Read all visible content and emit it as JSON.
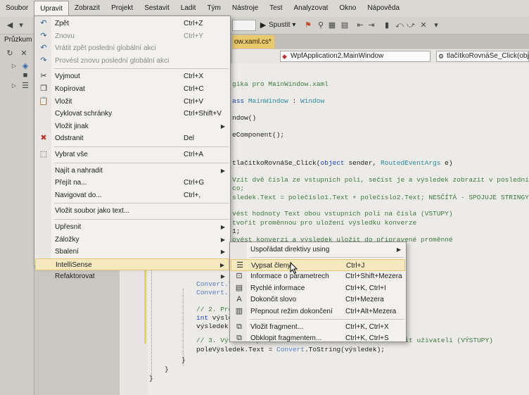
{
  "menubar": [
    "Soubor",
    "Upravit",
    "Zobrazit",
    "Projekt",
    "Sestavit",
    "Ladit",
    "Tým",
    "Nástroje",
    "Test",
    "Analyzovat",
    "Okno",
    "Nápověda"
  ],
  "toolbar": {
    "run_label": "Spustit",
    "run_arrow": "▾"
  },
  "explorer": {
    "title": "Průzkum"
  },
  "tab": {
    "label": "ow.xaml.cs*"
  },
  "nav": {
    "class_combo": "WpfApplication2.MainWindow",
    "member_combo": "tlačítkoRovnáSe_Click(object sen"
  },
  "edit_menu": [
    {
      "icon": "undo-icon",
      "glyph": "↶",
      "label": "Zpět",
      "shortcut": "Ctrl+Z",
      "enabled": true
    },
    {
      "icon": "redo-icon",
      "glyph": "↷",
      "label": "Znovu",
      "shortcut": "Ctrl+Y",
      "enabled": false
    },
    {
      "icon": "undo-global-icon",
      "glyph": "↶",
      "label": "Vrátit zpět poslední globální akci",
      "shortcut": "",
      "enabled": false
    },
    {
      "icon": "redo-global-icon",
      "glyph": "↷",
      "label": "Provést znovu poslední globální akci",
      "shortcut": "",
      "enabled": false
    },
    {
      "sep": true
    },
    {
      "icon": "cut-icon",
      "glyph": "✂",
      "label": "Vyjmout",
      "shortcut": "Ctrl+X",
      "enabled": true
    },
    {
      "icon": "copy-icon",
      "glyph": "❐",
      "label": "Kopírovat",
      "shortcut": "Ctrl+C",
      "enabled": true
    },
    {
      "icon": "paste-icon",
      "glyph": "📋",
      "label": "Vložit",
      "shortcut": "Ctrl+V",
      "enabled": true
    },
    {
      "icon": "",
      "glyph": "",
      "label": "Cyklovat schránky",
      "shortcut": "Ctrl+Shift+V",
      "enabled": true
    },
    {
      "icon": "",
      "glyph": "",
      "label": "Vložit jinak",
      "shortcut": "",
      "enabled": true,
      "submenu": true
    },
    {
      "icon": "delete-icon",
      "glyph": "✖",
      "label": "Odstranit",
      "shortcut": "Del",
      "enabled": true
    },
    {
      "sep": true
    },
    {
      "icon": "select-all-icon",
      "glyph": "⬚",
      "label": "Vybrat vše",
      "shortcut": "Ctrl+A",
      "enabled": true
    },
    {
      "sep": true
    },
    {
      "icon": "",
      "glyph": "",
      "label": "Najít a nahradit",
      "shortcut": "",
      "enabled": true,
      "submenu": true
    },
    {
      "icon": "",
      "glyph": "",
      "label": "Přejít na...",
      "shortcut": "Ctrl+G",
      "enabled": true
    },
    {
      "icon": "",
      "glyph": "",
      "label": "Navigovat do...",
      "shortcut": "Ctrl+,",
      "enabled": true
    },
    {
      "sep": true
    },
    {
      "icon": "",
      "glyph": "",
      "label": "Vložit soubor jako text...",
      "shortcut": "",
      "enabled": true
    },
    {
      "sep": true
    },
    {
      "icon": "",
      "glyph": "",
      "label": "Upřesnit",
      "shortcut": "",
      "enabled": true,
      "submenu": true
    },
    {
      "icon": "",
      "glyph": "",
      "label": "Záložky",
      "shortcut": "",
      "enabled": true,
      "submenu": true
    },
    {
      "icon": "",
      "glyph": "",
      "label": "Sbalení",
      "shortcut": "",
      "enabled": true,
      "submenu": true
    },
    {
      "icon": "",
      "glyph": "",
      "label": "IntelliSense",
      "shortcut": "",
      "enabled": true,
      "submenu": true,
      "highlight": true
    },
    {
      "icon": "",
      "glyph": "",
      "label": "Refaktorovat",
      "shortcut": "",
      "enabled": true,
      "submenu": true
    }
  ],
  "intellisense_menu": [
    {
      "icon": "",
      "glyph": "",
      "label": "Uspořádat direktivy using",
      "shortcut": "",
      "submenu": true
    },
    {
      "sep": true
    },
    {
      "icon": "list-members-icon",
      "glyph": "☰",
      "label": "Vypsat členy",
      "shortcut": "Ctrl+J",
      "highlight": true
    },
    {
      "icon": "parameter-info-icon",
      "glyph": "⊡",
      "label": "Informace o parametrech",
      "shortcut": "Ctrl+Shift+Mezera"
    },
    {
      "icon": "quick-info-icon",
      "glyph": "▤",
      "label": "Rychlé informace",
      "shortcut": "Ctrl+K, Ctrl+I"
    },
    {
      "icon": "complete-word-icon",
      "glyph": "A",
      "label": "Dokončit slovo",
      "shortcut": "Ctrl+Mezera"
    },
    {
      "icon": "toggle-completion-icon",
      "glyph": "▥",
      "label": "Přepnout režim dokončení",
      "shortcut": "Ctrl+Alt+Mezera"
    },
    {
      "sep": true
    },
    {
      "icon": "insert-snippet-icon",
      "glyph": "⧉",
      "label": "Vložit fragment...",
      "shortcut": "Ctrl+K, Ctrl+X"
    },
    {
      "icon": "surround-with-icon",
      "glyph": "⧉",
      "label": "Obklopit fragmentem...",
      "shortcut": "Ctrl+K, Ctrl+S"
    }
  ],
  "code": {
    "l1": "gika pro MainWindow.xaml",
    "l2a": "ass ",
    "l2b": "MainWindow",
    "l2c": " : ",
    "l2d": "Window",
    "l3": "ndow()",
    "l4": "eComponent();",
    "l5a": "tlačítkoRovnáSe_Click(",
    "l5b": "object",
    "l5c": " sender, ",
    "l5d": "RoutedEventArgs",
    "l5e": " e)",
    "c1": "Vzít dvě čísla ze vstupních polí, sečíst je a výsledek zobrazit v posledním poli",
    "c1b": "co;",
    "l6": "sledek.Text = polečíslo1.Text + polečíslo2.Text; NESČÍTÁ - SPOJUJE STRINGY",
    "c2": "vést hodnoty Text obou vstupních polí na čísla (VSTUPY)",
    "c3": "tvořit proměnnou pro uložení výsledku konverze",
    "c3b": "1;",
    "c4": "ovést konverzi a výsledek uložit do připravené proměnné",
    "l7": "Convert.T",
    "l8": "Convert.",
    "c5": "// 2. Pro",
    "l9a": "int",
    "l9b": " výsle",
    "l10": "výsledek",
    "c6": "// 3. Výsledek převést z čísla zase na text a zobrazit uživateli (VÝSTUPY)",
    "l11a": "poleVýsledek.Text = ",
    "l11b": "Convert",
    "l11c": ".ToString(výsledek);",
    "b1": "}",
    "b2": "}",
    "b3": "}"
  }
}
